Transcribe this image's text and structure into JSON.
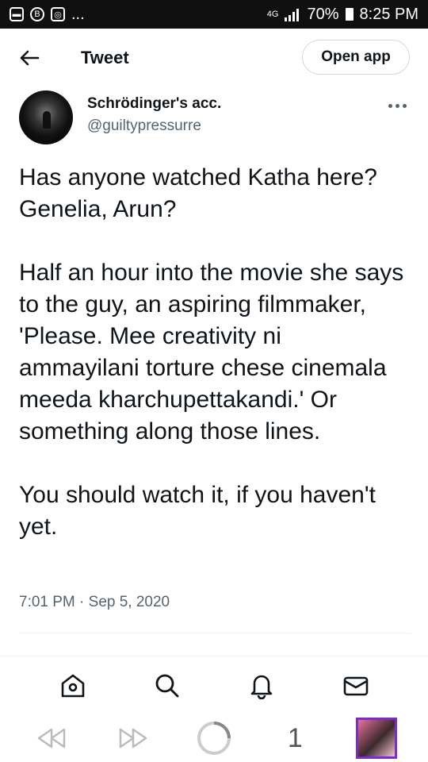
{
  "status_bar": {
    "dots": "...",
    "network": "4G",
    "battery": "70%",
    "time": "8:25 PM"
  },
  "header": {
    "title": "Tweet",
    "open_app_label": "Open app"
  },
  "author": {
    "name": "Schrödinger's acc.",
    "handle": "@guiltypressurre"
  },
  "tweet": {
    "paragraphs": [
      "Has anyone watched Katha here? Genelia, Arun?",
      "Half an hour into the movie she says to the guy, an aspiring filmmaker, 'Please. Mee creativity ni ammayilani torture chese cinemala meeda kharchupettakandi.' Or something along those lines.",
      "You should watch it, if you haven't yet."
    ],
    "timestamp": "7:01 PM · Sep 5, 2020"
  },
  "tab_bar": {
    "icons": [
      "home-icon",
      "search-icon",
      "notifications-icon",
      "messages-icon"
    ]
  },
  "browser_bar": {
    "tab_count": "1",
    "icons": [
      "back-icon",
      "forward-icon",
      "reload-icon",
      "tab-count",
      "profile-thumbnail"
    ]
  }
}
